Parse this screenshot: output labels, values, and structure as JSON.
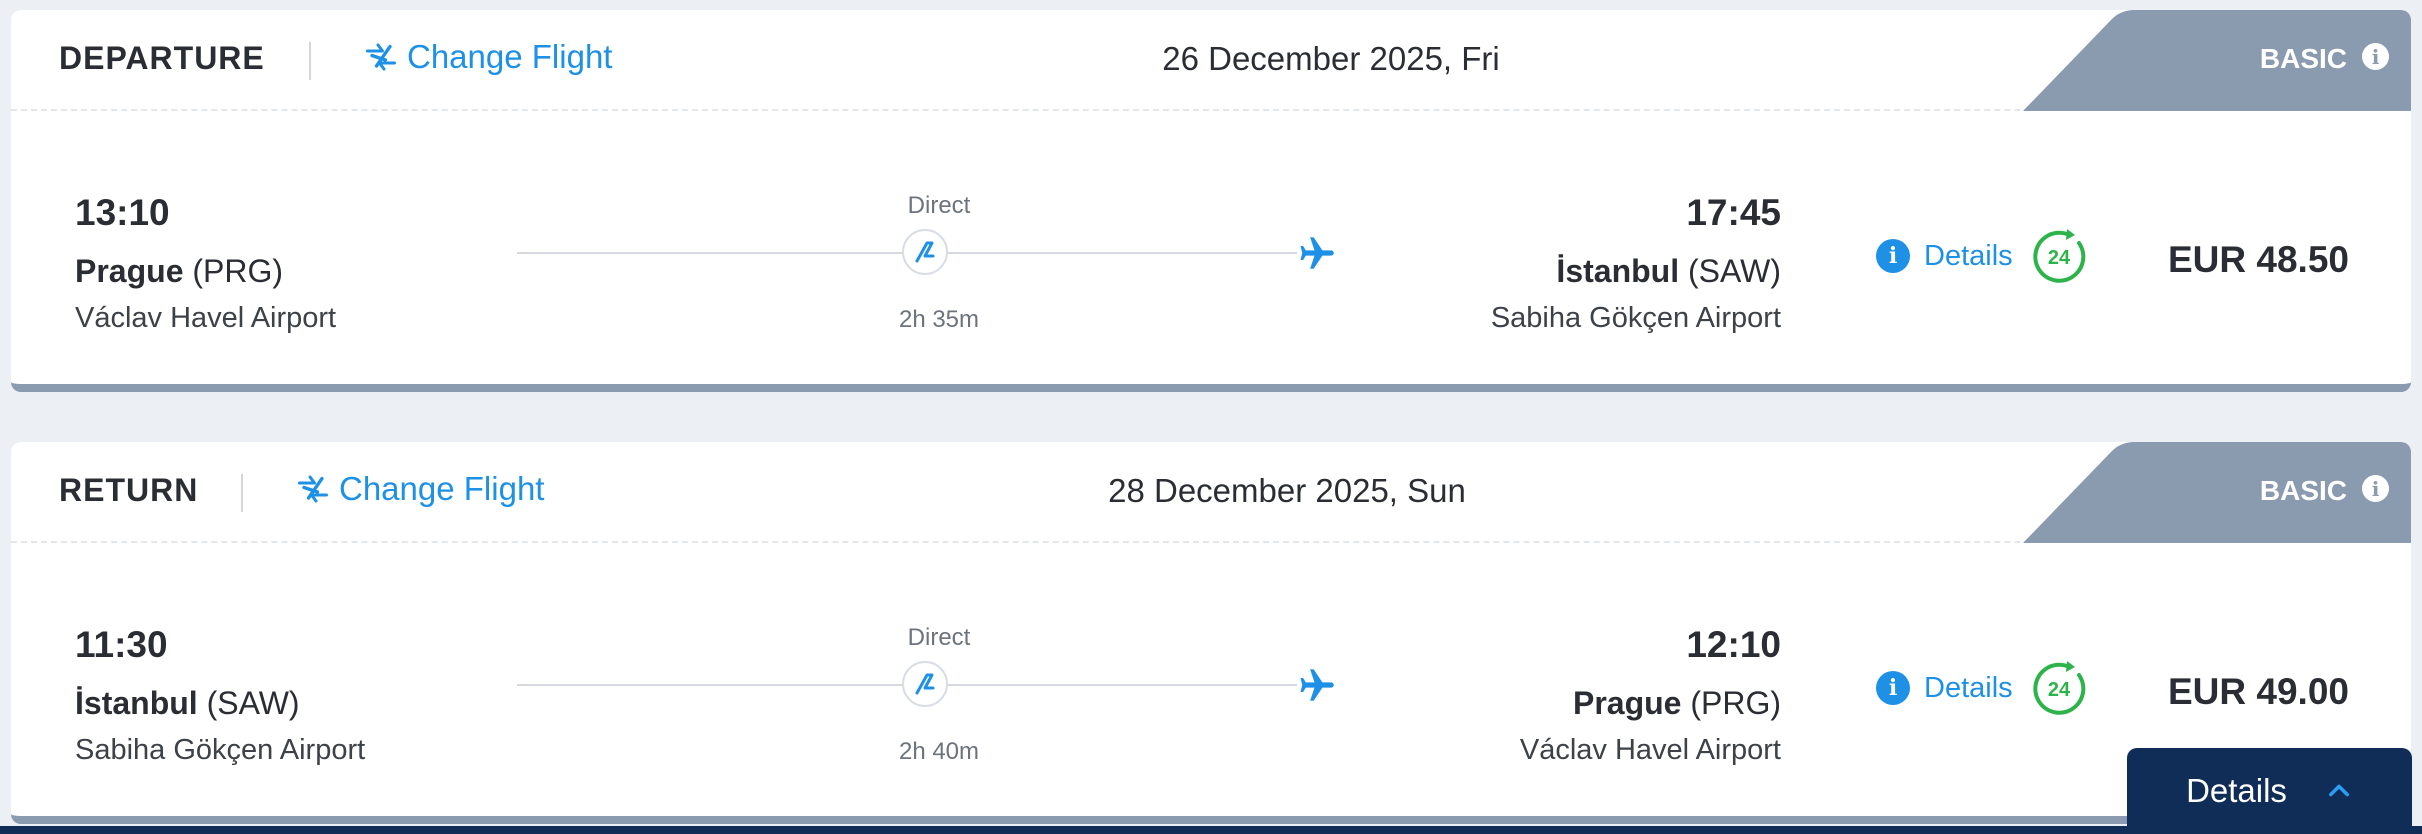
{
  "legs": [
    {
      "label": "DEPARTURE",
      "change_flight": "Change Flight",
      "date": "26 December 2025, Fri",
      "fare": "BASIC",
      "departure": {
        "time": "13:10",
        "city": "Prague",
        "code": "(PRG)",
        "airport": "Václav Havel Airport"
      },
      "stops": "Direct",
      "duration": "2h 35m",
      "arrival": {
        "time": "17:45",
        "city": "İstanbul",
        "code": "(SAW)",
        "airport": "Sabiha Gökçen Airport"
      },
      "details": "Details",
      "badge": "24",
      "price": "EUR 48.50"
    },
    {
      "label": "RETURN",
      "change_flight": "Change Flight",
      "date": "28 December 2025, Sun",
      "fare": "BASIC",
      "departure": {
        "time": "11:30",
        "city": "İstanbul",
        "code": "(SAW)",
        "airport": "Sabiha Gökçen Airport"
      },
      "stops": "Direct",
      "duration": "2h 40m",
      "arrival": {
        "time": "12:10",
        "city": "Prague",
        "code": "(PRG)",
        "airport": "Václav Havel Airport"
      },
      "details": "Details",
      "badge": "24",
      "price": "EUR 49.00"
    }
  ],
  "details_panel": {
    "label": "Details"
  },
  "colors": {
    "accent": "#1e90e6",
    "fare_tab": "#8a9aaf",
    "navy": "#0f2d57",
    "badge_green": "#2db34a"
  },
  "icons": [
    "change-flight-icon",
    "info-icon",
    "airline-logo",
    "plane-icon",
    "24h-badge-icon",
    "chevron-up-icon"
  ]
}
